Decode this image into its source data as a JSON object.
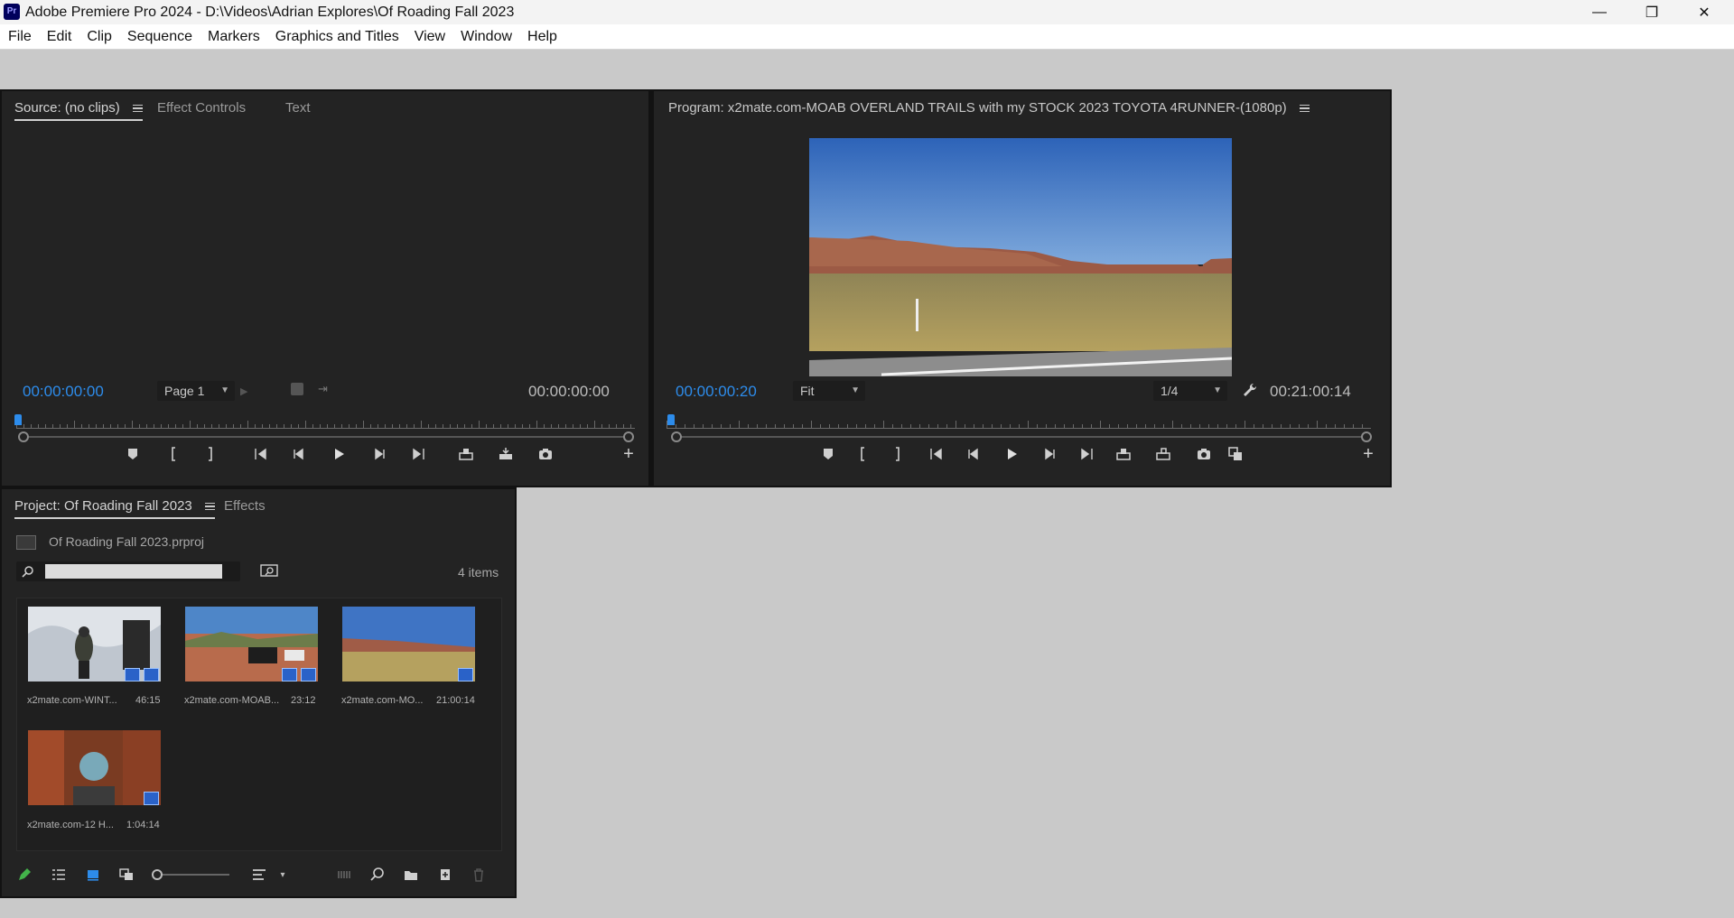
{
  "window": {
    "app_icon_text": "Pr",
    "title": "Adobe Premiere Pro 2024 - D:\\Videos\\Adrian Explores\\Of Roading Fall 2023",
    "minimize": "—",
    "restore": "❐",
    "close": "✕"
  },
  "menu": [
    "File",
    "Edit",
    "Clip",
    "Sequence",
    "Markers",
    "Graphics and Titles",
    "View",
    "Window",
    "Help"
  ],
  "source": {
    "tabs": [
      "Source: (no clips)",
      "Effect Controls",
      "Text"
    ],
    "timecode_left": "00:00:00:00",
    "page_select": "Page 1",
    "timecode_right": "00:00:00:00"
  },
  "program": {
    "tab": "Program: x2mate.com-MOAB OVERLAND TRAILS with my STOCK 2023 TOYOTA 4RUNNER-(1080p)",
    "timecode_left": "00:00:00:20",
    "zoom_select": "Fit",
    "resolution_select": "1/4",
    "timecode_right": "00:21:00:14"
  },
  "project": {
    "tabs": [
      "Project: Of Roading Fall 2023",
      "Effects"
    ],
    "file_name": "Of Roading Fall 2023.prproj",
    "search_value": "",
    "item_count": "4 items",
    "items": [
      {
        "label": "x2mate.com-WINT...",
        "duration": "46:15"
      },
      {
        "label": "x2mate.com-MOAB...",
        "duration": "23:12"
      },
      {
        "label": "x2mate.com-MO...",
        "duration": "21:00:14"
      },
      {
        "label": "x2mate.com-12 H...",
        "duration": "1:04:14"
      }
    ]
  },
  "colors": {
    "accent_blue": "#2d8ceb",
    "panel_bg": "#232323",
    "workspace_bg": "#c9c9c9"
  }
}
